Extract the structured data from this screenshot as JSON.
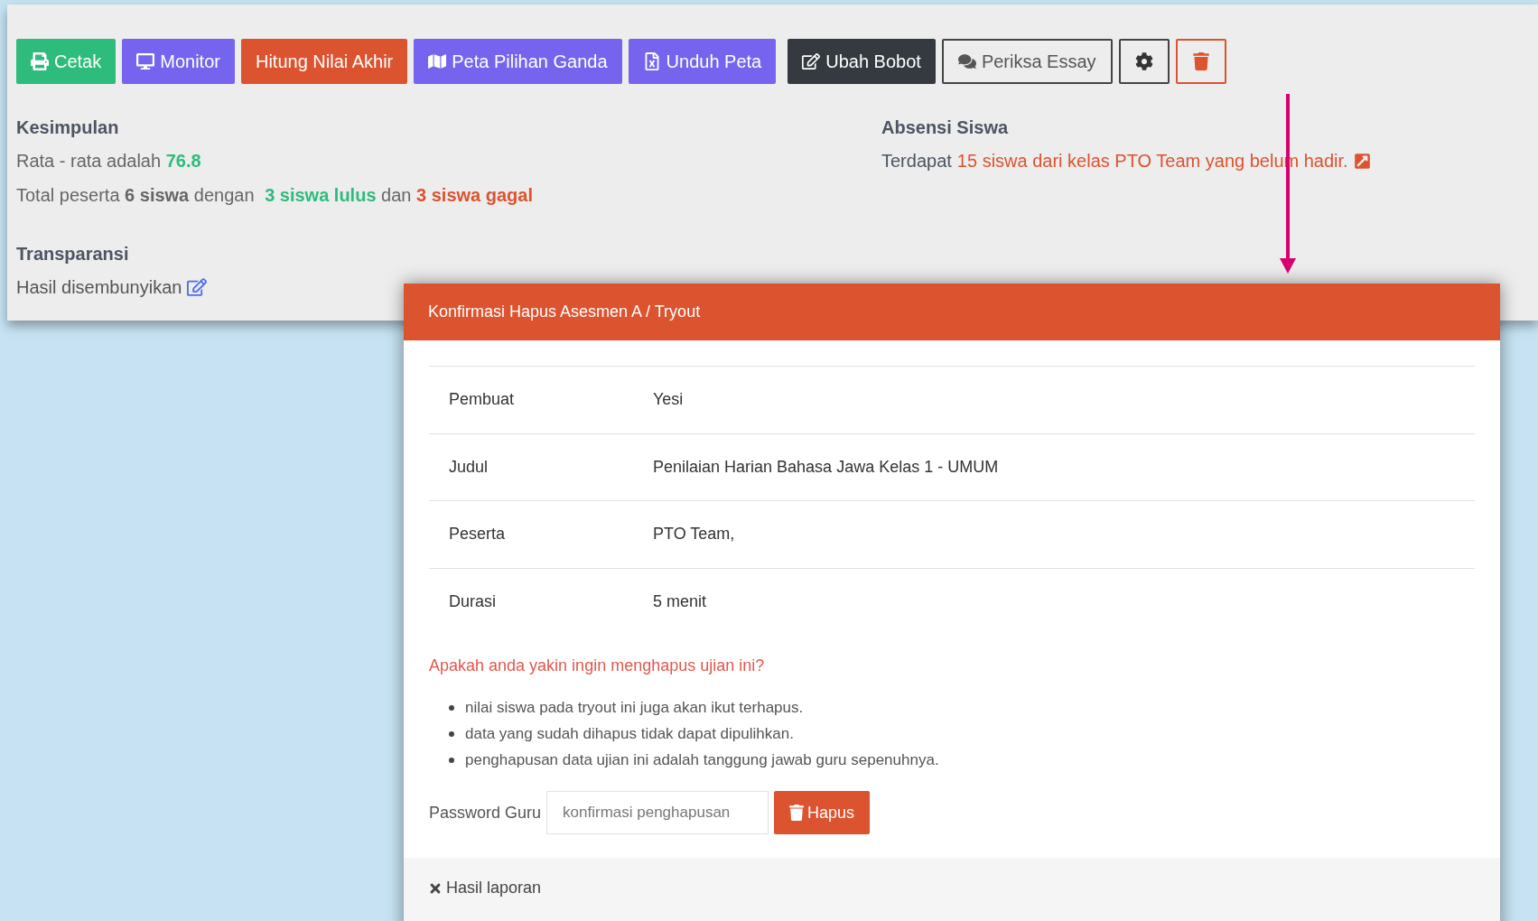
{
  "toolbar": {
    "buttons": [
      {
        "kind": "print",
        "label": "Cetak"
      },
      {
        "kind": "monitor",
        "label": "Monitor"
      },
      {
        "kind": "calculate",
        "label": "Hitung Nilai Akhir"
      },
      {
        "kind": "map",
        "label": "Peta Pilihan Ganda"
      },
      {
        "kind": "download",
        "label": "Unduh Peta"
      },
      {
        "kind": "edit",
        "label": "Ubah Bobot"
      },
      {
        "kind": "chat",
        "label": "Periksa Essay"
      },
      {
        "kind": "settings"
      },
      {
        "kind": "delete"
      }
    ]
  },
  "summary": {
    "title": "Kesimpulan",
    "average": {
      "prefix": "Rata - rata adalah",
      "value": "76.8"
    },
    "total": {
      "prefix": "Total peserta",
      "count": "6 siswa",
      "middle": "dengan",
      "passed": "3 siswa lulus",
      "joiner": "dan",
      "failed": "3 siswa gagal"
    }
  },
  "transparency": {
    "title": "Transparansi",
    "status": "Hasil disembunyikan"
  },
  "attendance": {
    "title": "Absensi Siswa",
    "prefix": "Terdapat",
    "message": "15 siswa dari kelas PTO Team yang belum hadir."
  },
  "dialog": {
    "title": "Konfirmasi Hapus Asesmen A / Tryout",
    "details": [
      {
        "label": "Pembuat",
        "value": "Yesi"
      },
      {
        "label": "Judul",
        "value": "Penilaian Harian Bahasa Jawa Kelas 1 - UMUM"
      },
      {
        "label": "Peserta",
        "value": "PTO Team,"
      },
      {
        "label": "Durasi",
        "value": "5 menit"
      }
    ],
    "question": "Apakah anda yakin ingin menghapus ujian ini?",
    "warnings": [
      "nilai siswa pada tryout ini juga akan ikut terhapus.",
      "data yang sudah dihapus tidak dapat dipulihkan.",
      "penghapusan data ujian ini adalah tanggung jawab guru sepenuhnya."
    ],
    "password": {
      "label": "Password Guru",
      "placeholder": "konfirmasi penghapusan"
    },
    "confirm_button": "Hapus",
    "footer_link": "Hasil laporan"
  }
}
